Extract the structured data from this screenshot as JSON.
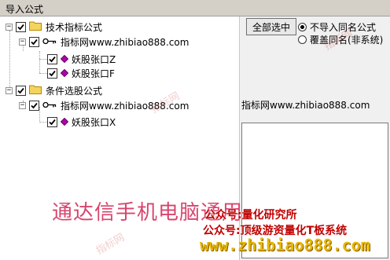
{
  "window": {
    "title": "导入公式"
  },
  "tree": {
    "group1": {
      "label": "技术指标公式"
    },
    "group1_source": {
      "label": "指标网www.zhibiao888.com"
    },
    "group1_items": [
      "妖股张口Z",
      "妖股张口F"
    ],
    "group2": {
      "label": "条件选股公式"
    },
    "group2_source": {
      "label": "指标网www.zhibiao888.com"
    },
    "group2_items": [
      "妖股张口X"
    ]
  },
  "controls": {
    "select_all_label": "全部选中",
    "radio_no_import": "不导入同名公式",
    "radio_overwrite": "覆盖同名(非系统)"
  },
  "details": {
    "name": "指标网www.zhibiao888.com"
  },
  "watermarks": {
    "big": "通达信手机电脑通用",
    "line1": "公众号:量化研究所",
    "line2": "公众号:顶级游资量化T板系统",
    "url": "www.zhibiao888.com",
    "faint": "指标网"
  }
}
